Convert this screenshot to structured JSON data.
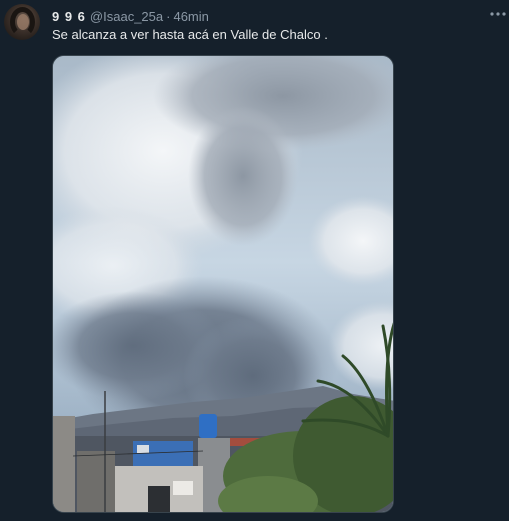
{
  "tweet": {
    "display_name": "9 9 6",
    "handle": "@Isaac_25a",
    "separator": "·",
    "time": "46min",
    "text": "Se alcanza a ver hasta acá en Valle de Chalco .",
    "more_icon": "more-horizontal-icon"
  },
  "media": {
    "description_icon": "photo"
  },
  "colors": {
    "background": "#15202b",
    "primary_text": "#e7e9ea",
    "secondary_text": "#8b98a5",
    "border": "#38444d"
  }
}
